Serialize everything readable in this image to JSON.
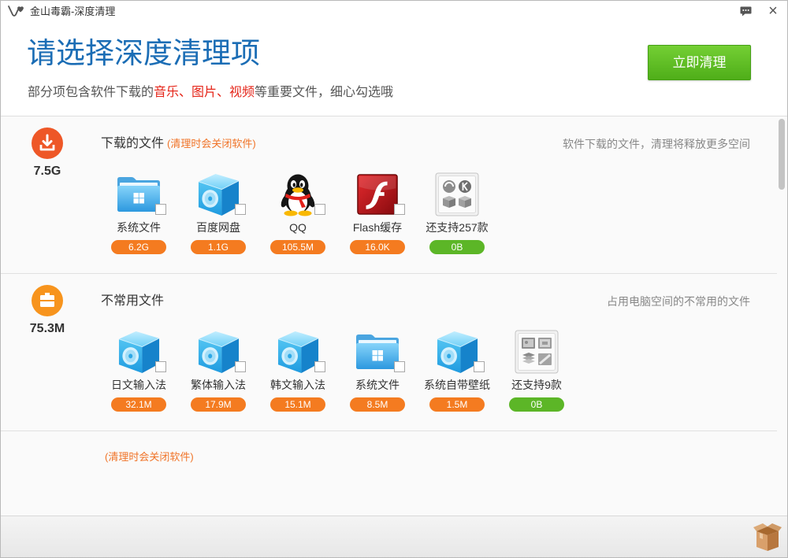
{
  "window": {
    "title": "金山毒霸-深度清理",
    "app_icon": "kingsoft-logo-icon",
    "feedback_icon": "chat-bubble-icon",
    "close_label": "×"
  },
  "header": {
    "title": "请选择深度清理项",
    "subtitle": {
      "before": "部分项包含软件下载的",
      "highlight": "音乐、图片、视频",
      "after": "等重要文件，细心勾选哦"
    },
    "clean_button": "立即清理"
  },
  "colors": {
    "title_blue": "#1b6db5",
    "highlight_red": "#e5261a",
    "note_orange": "#f07327",
    "button_green": "#55b51b"
  },
  "sections": [
    {
      "icon": "download-arrow-icon",
      "icon_color": "#ee5727",
      "total_size": "7.5G",
      "title": "下载的文件",
      "note": "(清理时会关闭软件)",
      "description": "软件下载的文件，清理将释放更多空间",
      "items": [
        {
          "label": "系统文件",
          "size": "6.2G",
          "icon": "windows-folder-icon",
          "size_color": "#f47b20"
        },
        {
          "label": "百度网盘",
          "size": "1.1G",
          "icon": "blue-cube-disc-icon",
          "size_color": "#f47b20"
        },
        {
          "label": "QQ",
          "size": "105.5M",
          "icon": "qq-penguin-icon",
          "size_color": "#f47b20"
        },
        {
          "label": "Flash缓存",
          "size": "16.0K",
          "icon": "flash-icon",
          "size_color": "#f47b20"
        },
        {
          "label": "还支持257款",
          "size": "0B",
          "icon": "more-apps-box-icon",
          "size_color": "#5cb627"
        }
      ]
    },
    {
      "icon": "briefcase-icon",
      "icon_color": "#f7941d",
      "total_size": "75.3M",
      "title": "不常用文件",
      "description": "占用电脑空间的不常用的文件",
      "items": [
        {
          "label": "日文输入法",
          "size": "32.1M",
          "icon": "blue-cube-disc-icon",
          "size_color": "#f47b20"
        },
        {
          "label": "繁体输入法",
          "size": "17.9M",
          "icon": "blue-cube-disc-icon",
          "size_color": "#f47b20"
        },
        {
          "label": "韩文输入法",
          "size": "15.1M",
          "icon": "blue-cube-disc-icon",
          "size_color": "#f47b20"
        },
        {
          "label": "系统文件",
          "size": "8.5M",
          "icon": "windows-folder-icon",
          "size_color": "#f47b20"
        },
        {
          "label": "系统自带壁纸",
          "size": "1.5M",
          "icon": "blue-cube-disc-icon",
          "size_color": "#f47b20"
        },
        {
          "label": "还支持9款",
          "size": "0B",
          "icon": "more-apps-box-icon",
          "size_color": "#5cb627"
        }
      ]
    },
    {
      "note": "(清理时会关闭软件)"
    }
  ],
  "footer": {
    "icon": "cardboard-box-icon"
  }
}
